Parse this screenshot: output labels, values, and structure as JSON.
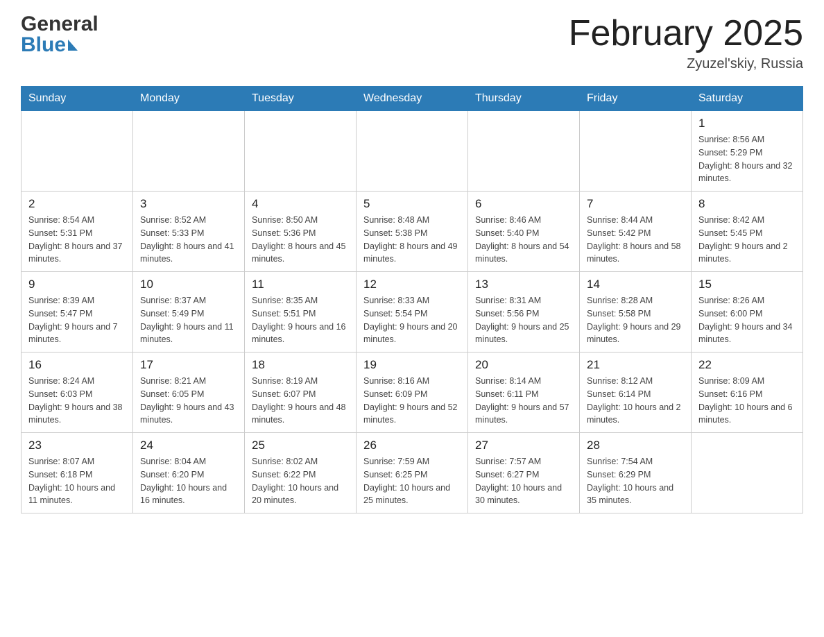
{
  "header": {
    "logo_line1": "General",
    "logo_line2": "Blue",
    "month_title": "February 2025",
    "location": "Zyuzel'skiy, Russia"
  },
  "calendar": {
    "days_of_week": [
      "Sunday",
      "Monday",
      "Tuesday",
      "Wednesday",
      "Thursday",
      "Friday",
      "Saturday"
    ],
    "weeks": [
      [
        {
          "day": "",
          "info": ""
        },
        {
          "day": "",
          "info": ""
        },
        {
          "day": "",
          "info": ""
        },
        {
          "day": "",
          "info": ""
        },
        {
          "day": "",
          "info": ""
        },
        {
          "day": "",
          "info": ""
        },
        {
          "day": "1",
          "info": "Sunrise: 8:56 AM\nSunset: 5:29 PM\nDaylight: 8 hours and 32 minutes."
        }
      ],
      [
        {
          "day": "2",
          "info": "Sunrise: 8:54 AM\nSunset: 5:31 PM\nDaylight: 8 hours and 37 minutes."
        },
        {
          "day": "3",
          "info": "Sunrise: 8:52 AM\nSunset: 5:33 PM\nDaylight: 8 hours and 41 minutes."
        },
        {
          "day": "4",
          "info": "Sunrise: 8:50 AM\nSunset: 5:36 PM\nDaylight: 8 hours and 45 minutes."
        },
        {
          "day": "5",
          "info": "Sunrise: 8:48 AM\nSunset: 5:38 PM\nDaylight: 8 hours and 49 minutes."
        },
        {
          "day": "6",
          "info": "Sunrise: 8:46 AM\nSunset: 5:40 PM\nDaylight: 8 hours and 54 minutes."
        },
        {
          "day": "7",
          "info": "Sunrise: 8:44 AM\nSunset: 5:42 PM\nDaylight: 8 hours and 58 minutes."
        },
        {
          "day": "8",
          "info": "Sunrise: 8:42 AM\nSunset: 5:45 PM\nDaylight: 9 hours and 2 minutes."
        }
      ],
      [
        {
          "day": "9",
          "info": "Sunrise: 8:39 AM\nSunset: 5:47 PM\nDaylight: 9 hours and 7 minutes."
        },
        {
          "day": "10",
          "info": "Sunrise: 8:37 AM\nSunset: 5:49 PM\nDaylight: 9 hours and 11 minutes."
        },
        {
          "day": "11",
          "info": "Sunrise: 8:35 AM\nSunset: 5:51 PM\nDaylight: 9 hours and 16 minutes."
        },
        {
          "day": "12",
          "info": "Sunrise: 8:33 AM\nSunset: 5:54 PM\nDaylight: 9 hours and 20 minutes."
        },
        {
          "day": "13",
          "info": "Sunrise: 8:31 AM\nSunset: 5:56 PM\nDaylight: 9 hours and 25 minutes."
        },
        {
          "day": "14",
          "info": "Sunrise: 8:28 AM\nSunset: 5:58 PM\nDaylight: 9 hours and 29 minutes."
        },
        {
          "day": "15",
          "info": "Sunrise: 8:26 AM\nSunset: 6:00 PM\nDaylight: 9 hours and 34 minutes."
        }
      ],
      [
        {
          "day": "16",
          "info": "Sunrise: 8:24 AM\nSunset: 6:03 PM\nDaylight: 9 hours and 38 minutes."
        },
        {
          "day": "17",
          "info": "Sunrise: 8:21 AM\nSunset: 6:05 PM\nDaylight: 9 hours and 43 minutes."
        },
        {
          "day": "18",
          "info": "Sunrise: 8:19 AM\nSunset: 6:07 PM\nDaylight: 9 hours and 48 minutes."
        },
        {
          "day": "19",
          "info": "Sunrise: 8:16 AM\nSunset: 6:09 PM\nDaylight: 9 hours and 52 minutes."
        },
        {
          "day": "20",
          "info": "Sunrise: 8:14 AM\nSunset: 6:11 PM\nDaylight: 9 hours and 57 minutes."
        },
        {
          "day": "21",
          "info": "Sunrise: 8:12 AM\nSunset: 6:14 PM\nDaylight: 10 hours and 2 minutes."
        },
        {
          "day": "22",
          "info": "Sunrise: 8:09 AM\nSunset: 6:16 PM\nDaylight: 10 hours and 6 minutes."
        }
      ],
      [
        {
          "day": "23",
          "info": "Sunrise: 8:07 AM\nSunset: 6:18 PM\nDaylight: 10 hours and 11 minutes."
        },
        {
          "day": "24",
          "info": "Sunrise: 8:04 AM\nSunset: 6:20 PM\nDaylight: 10 hours and 16 minutes."
        },
        {
          "day": "25",
          "info": "Sunrise: 8:02 AM\nSunset: 6:22 PM\nDaylight: 10 hours and 20 minutes."
        },
        {
          "day": "26",
          "info": "Sunrise: 7:59 AM\nSunset: 6:25 PM\nDaylight: 10 hours and 25 minutes."
        },
        {
          "day": "27",
          "info": "Sunrise: 7:57 AM\nSunset: 6:27 PM\nDaylight: 10 hours and 30 minutes."
        },
        {
          "day": "28",
          "info": "Sunrise: 7:54 AM\nSunset: 6:29 PM\nDaylight: 10 hours and 35 minutes."
        },
        {
          "day": "",
          "info": ""
        }
      ]
    ]
  }
}
